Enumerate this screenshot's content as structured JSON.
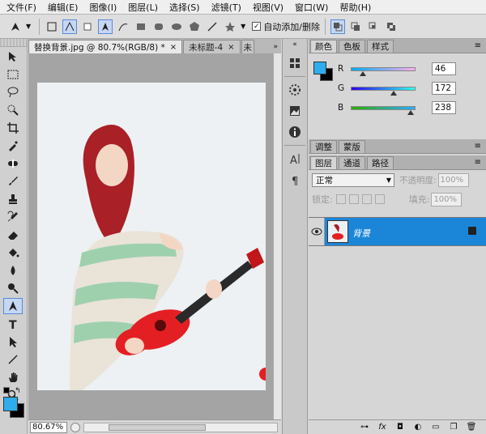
{
  "menu": {
    "items": [
      "文件(F)",
      "编辑(E)",
      "图像(I)",
      "图层(L)",
      "选择(S)",
      "滤镜(T)",
      "视图(V)",
      "窗口(W)",
      "帮助(H)"
    ]
  },
  "options": {
    "auto_add_delete": "自动添加/删除"
  },
  "documents": {
    "tabs": [
      {
        "label": "替换背景.jpg @ 80.7%(RGB/8) *",
        "close": "×"
      },
      {
        "label": "未标题-4",
        "close": "×"
      },
      {
        "label": "未"
      }
    ]
  },
  "status": {
    "zoom": "80.67%"
  },
  "color_panel": {
    "tabs": [
      "颜色",
      "色板",
      "样式"
    ],
    "channels": [
      {
        "label": "R",
        "value": "46",
        "fraction": 0.18
      },
      {
        "label": "G",
        "value": "172",
        "fraction": 0.67
      },
      {
        "label": "B",
        "value": "238",
        "fraction": 0.93
      }
    ],
    "foreground": "#2eacee",
    "background": "#000000"
  },
  "adjust_panel": {
    "tabs": [
      "调整",
      "蒙版"
    ]
  },
  "layers_panel": {
    "tabs": [
      "图层",
      "通道",
      "路径"
    ],
    "blend_mode": "正常",
    "opacity_label": "不透明度:",
    "opacity_value": "100%",
    "lock_label": "锁定:",
    "fill_label": "填充:",
    "fill_value": "100%",
    "layer_name": "背景"
  },
  "colors": {
    "selection": "#1b86d8",
    "accent_foreground": "#2eacee"
  }
}
